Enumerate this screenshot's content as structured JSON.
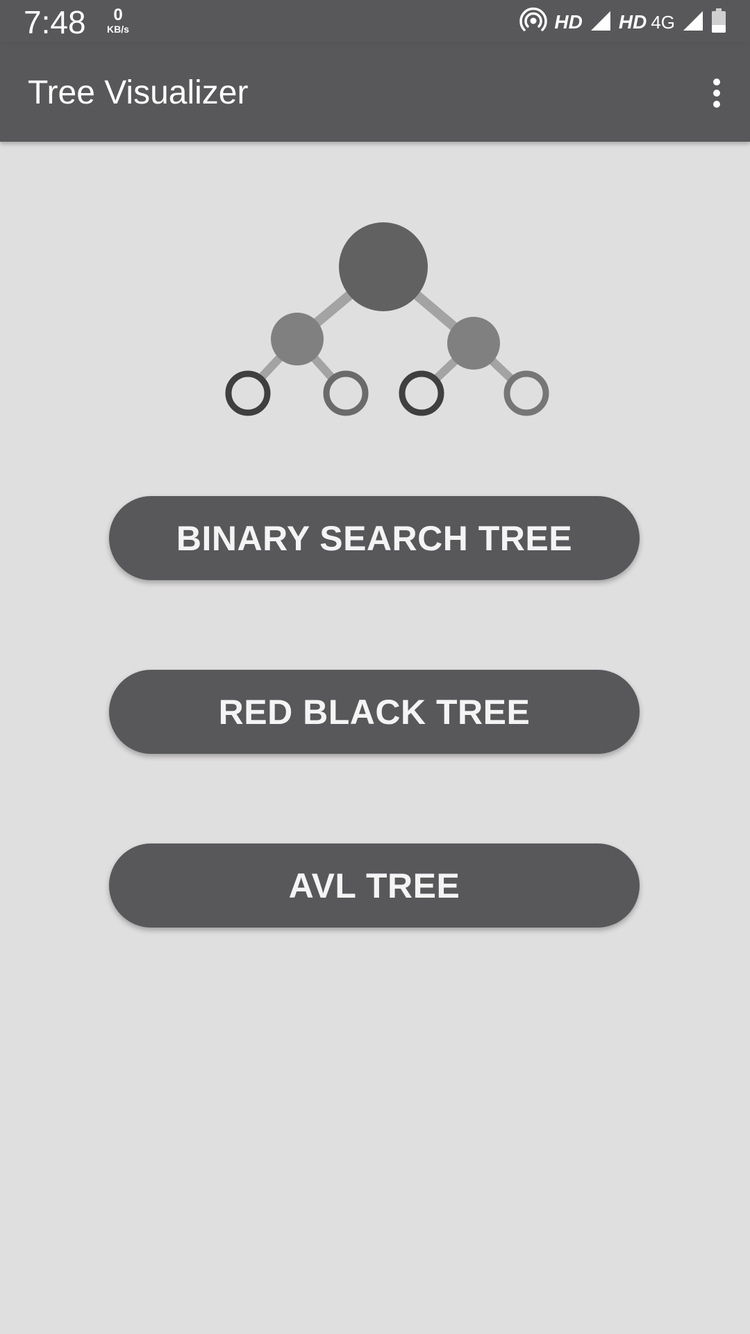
{
  "status_bar": {
    "time": "7:48",
    "speed_value": "0",
    "speed_unit": "KB/s",
    "hd_label_1": "HD",
    "hd_label_2": "HD",
    "network_label": "4G",
    "icons": [
      "hotspot-icon",
      "signal-icon",
      "signal-icon",
      "battery-icon"
    ]
  },
  "app_bar": {
    "title": "Tree Visualizer",
    "menu_icon": "more-vert-icon"
  },
  "illustration": {
    "icon": "binary-tree-icon"
  },
  "buttons": {
    "bst": "BINARY SEARCH TREE",
    "rbt": "RED BLACK TREE",
    "avl": "AVL TREE"
  },
  "colors": {
    "bar": "#58585b",
    "background": "#e0dfdf",
    "button": "#58585b",
    "button_text": "#f4f4f4",
    "node_dark": "#616161",
    "node_mid": "#808080",
    "edge": "#a3a3a3"
  }
}
